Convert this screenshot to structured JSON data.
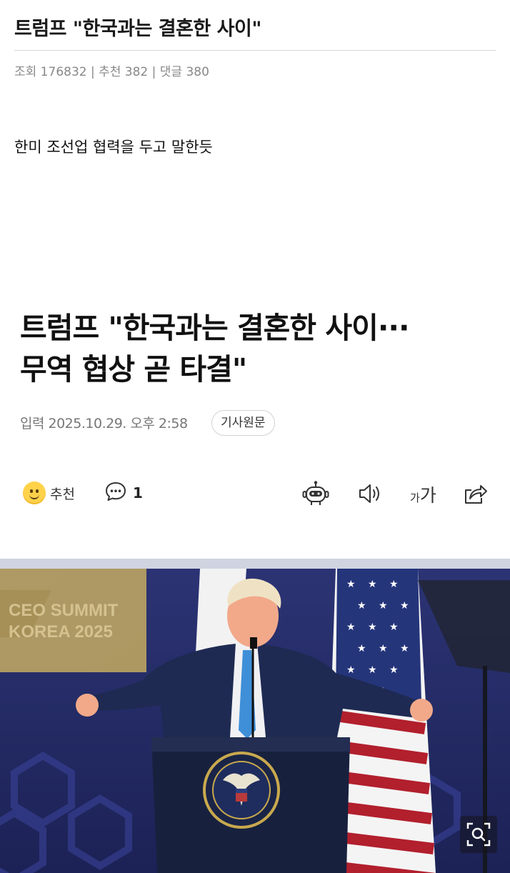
{
  "post": {
    "title": "트럼프 \"한국과는 결혼한 사이\"",
    "meta": "조회 176832 | 추천 382 | 댓글 380",
    "body": "한미 조선업 협력을 두고 말한듯"
  },
  "article": {
    "headline_line1": "트럼프 \"한국과는 결혼한 사이···",
    "headline_line2": "무역 협상 곧 타결\"",
    "date": "입력 2025.10.29. 오후 2:58",
    "source_button": "기사원문"
  },
  "actions": {
    "like_label": "추천",
    "comment_count": "1",
    "font_small": "가",
    "font_large": "가"
  },
  "photo": {
    "banner_line1": "CEO SUMMIT",
    "banner_line2": "KOREA 2025"
  },
  "colors": {
    "accent_blue": "#26306a",
    "smiley_yellow": "#ffd24a",
    "divider": "#d6d6d6"
  },
  "icons": [
    "smiley-icon",
    "comment-icon",
    "robot-icon",
    "speaker-icon",
    "share-icon",
    "zoom-icon"
  ]
}
